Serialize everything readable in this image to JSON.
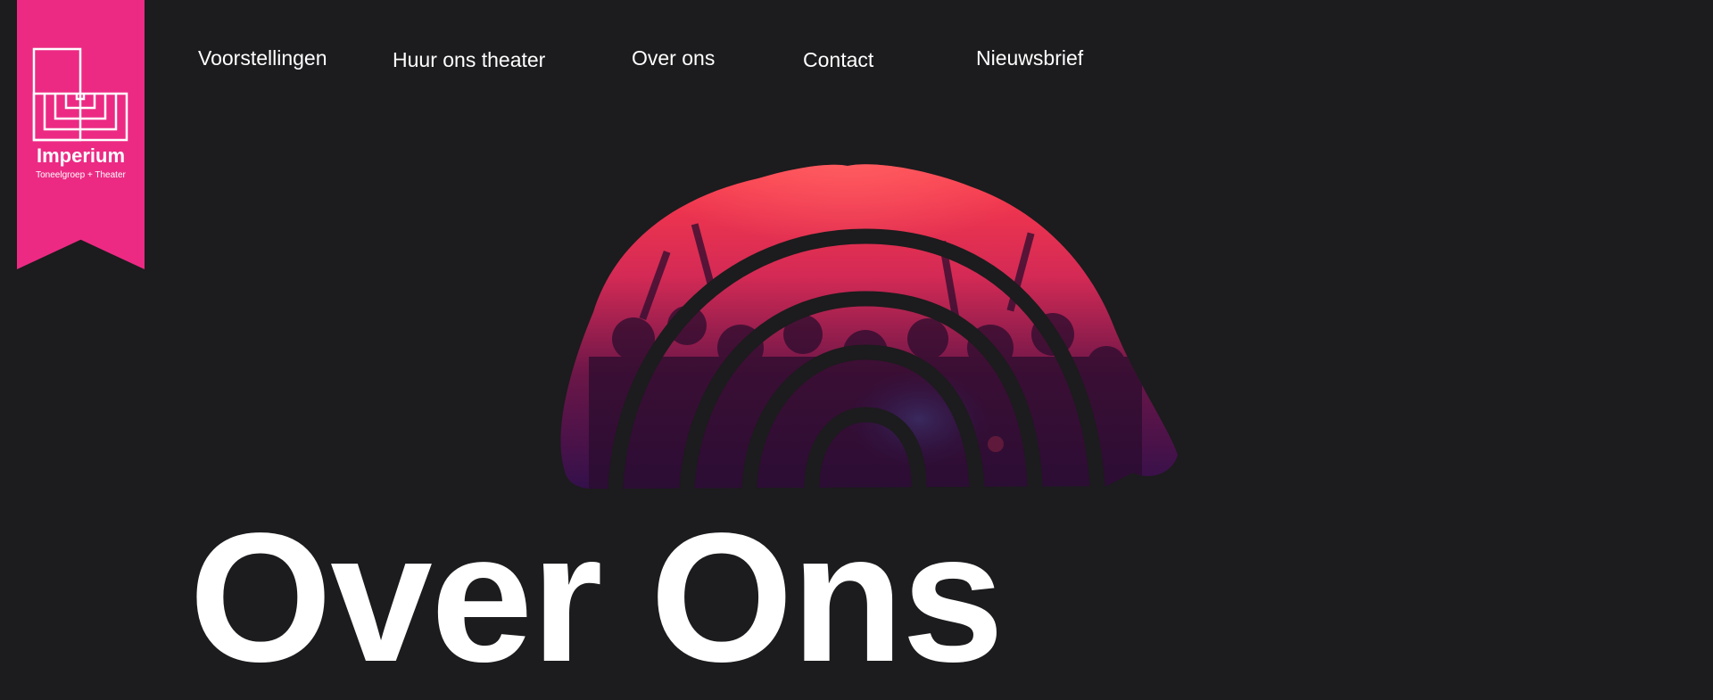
{
  "brand": {
    "name": "Imperium",
    "tagline": "Toneelgroep + Theater",
    "color": "#ec2a84"
  },
  "nav": {
    "items": [
      {
        "label": "Voorstellingen"
      },
      {
        "label": "Huur ons theater"
      },
      {
        "label": "Over ons"
      },
      {
        "label": "Contact"
      },
      {
        "label": "Nieuwsbrief"
      }
    ]
  },
  "hero": {
    "title": "Over Ons",
    "image_icon": "theater-arch-crowd-image"
  },
  "colors": {
    "background": "#1c1b1d",
    "accent": "#ec2a84",
    "text": "#ffffff"
  }
}
